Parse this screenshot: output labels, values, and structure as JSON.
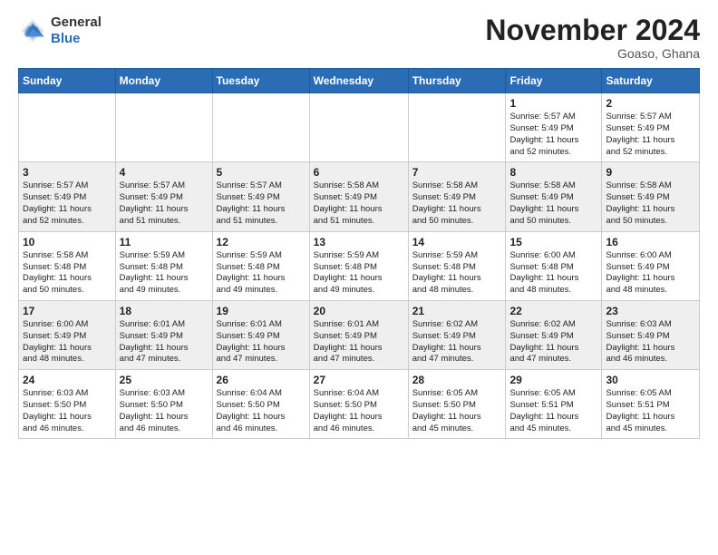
{
  "logo": {
    "general": "General",
    "blue": "Blue"
  },
  "header": {
    "month": "November 2024",
    "location": "Goaso, Ghana"
  },
  "days_of_week": [
    "Sunday",
    "Monday",
    "Tuesday",
    "Wednesday",
    "Thursday",
    "Friday",
    "Saturday"
  ],
  "weeks": [
    {
      "row": 1,
      "days": [
        {
          "num": "",
          "info": ""
        },
        {
          "num": "",
          "info": ""
        },
        {
          "num": "",
          "info": ""
        },
        {
          "num": "",
          "info": ""
        },
        {
          "num": "",
          "info": ""
        },
        {
          "num": "1",
          "info": "Sunrise: 5:57 AM\nSunset: 5:49 PM\nDaylight: 11 hours\nand 52 minutes."
        },
        {
          "num": "2",
          "info": "Sunrise: 5:57 AM\nSunset: 5:49 PM\nDaylight: 11 hours\nand 52 minutes."
        }
      ]
    },
    {
      "row": 2,
      "days": [
        {
          "num": "3",
          "info": "Sunrise: 5:57 AM\nSunset: 5:49 PM\nDaylight: 11 hours\nand 52 minutes."
        },
        {
          "num": "4",
          "info": "Sunrise: 5:57 AM\nSunset: 5:49 PM\nDaylight: 11 hours\nand 51 minutes."
        },
        {
          "num": "5",
          "info": "Sunrise: 5:57 AM\nSunset: 5:49 PM\nDaylight: 11 hours\nand 51 minutes."
        },
        {
          "num": "6",
          "info": "Sunrise: 5:58 AM\nSunset: 5:49 PM\nDaylight: 11 hours\nand 51 minutes."
        },
        {
          "num": "7",
          "info": "Sunrise: 5:58 AM\nSunset: 5:49 PM\nDaylight: 11 hours\nand 50 minutes."
        },
        {
          "num": "8",
          "info": "Sunrise: 5:58 AM\nSunset: 5:49 PM\nDaylight: 11 hours\nand 50 minutes."
        },
        {
          "num": "9",
          "info": "Sunrise: 5:58 AM\nSunset: 5:49 PM\nDaylight: 11 hours\nand 50 minutes."
        }
      ]
    },
    {
      "row": 3,
      "days": [
        {
          "num": "10",
          "info": "Sunrise: 5:58 AM\nSunset: 5:48 PM\nDaylight: 11 hours\nand 50 minutes."
        },
        {
          "num": "11",
          "info": "Sunrise: 5:59 AM\nSunset: 5:48 PM\nDaylight: 11 hours\nand 49 minutes."
        },
        {
          "num": "12",
          "info": "Sunrise: 5:59 AM\nSunset: 5:48 PM\nDaylight: 11 hours\nand 49 minutes."
        },
        {
          "num": "13",
          "info": "Sunrise: 5:59 AM\nSunset: 5:48 PM\nDaylight: 11 hours\nand 49 minutes."
        },
        {
          "num": "14",
          "info": "Sunrise: 5:59 AM\nSunset: 5:48 PM\nDaylight: 11 hours\nand 48 minutes."
        },
        {
          "num": "15",
          "info": "Sunrise: 6:00 AM\nSunset: 5:48 PM\nDaylight: 11 hours\nand 48 minutes."
        },
        {
          "num": "16",
          "info": "Sunrise: 6:00 AM\nSunset: 5:49 PM\nDaylight: 11 hours\nand 48 minutes."
        }
      ]
    },
    {
      "row": 4,
      "days": [
        {
          "num": "17",
          "info": "Sunrise: 6:00 AM\nSunset: 5:49 PM\nDaylight: 11 hours\nand 48 minutes."
        },
        {
          "num": "18",
          "info": "Sunrise: 6:01 AM\nSunset: 5:49 PM\nDaylight: 11 hours\nand 47 minutes."
        },
        {
          "num": "19",
          "info": "Sunrise: 6:01 AM\nSunset: 5:49 PM\nDaylight: 11 hours\nand 47 minutes."
        },
        {
          "num": "20",
          "info": "Sunrise: 6:01 AM\nSunset: 5:49 PM\nDaylight: 11 hours\nand 47 minutes."
        },
        {
          "num": "21",
          "info": "Sunrise: 6:02 AM\nSunset: 5:49 PM\nDaylight: 11 hours\nand 47 minutes."
        },
        {
          "num": "22",
          "info": "Sunrise: 6:02 AM\nSunset: 5:49 PM\nDaylight: 11 hours\nand 47 minutes."
        },
        {
          "num": "23",
          "info": "Sunrise: 6:03 AM\nSunset: 5:49 PM\nDaylight: 11 hours\nand 46 minutes."
        }
      ]
    },
    {
      "row": 5,
      "days": [
        {
          "num": "24",
          "info": "Sunrise: 6:03 AM\nSunset: 5:50 PM\nDaylight: 11 hours\nand 46 minutes."
        },
        {
          "num": "25",
          "info": "Sunrise: 6:03 AM\nSunset: 5:50 PM\nDaylight: 11 hours\nand 46 minutes."
        },
        {
          "num": "26",
          "info": "Sunrise: 6:04 AM\nSunset: 5:50 PM\nDaylight: 11 hours\nand 46 minutes."
        },
        {
          "num": "27",
          "info": "Sunrise: 6:04 AM\nSunset: 5:50 PM\nDaylight: 11 hours\nand 46 minutes."
        },
        {
          "num": "28",
          "info": "Sunrise: 6:05 AM\nSunset: 5:50 PM\nDaylight: 11 hours\nand 45 minutes."
        },
        {
          "num": "29",
          "info": "Sunrise: 6:05 AM\nSunset: 5:51 PM\nDaylight: 11 hours\nand 45 minutes."
        },
        {
          "num": "30",
          "info": "Sunrise: 6:05 AM\nSunset: 5:51 PM\nDaylight: 11 hours\nand 45 minutes."
        }
      ]
    }
  ]
}
